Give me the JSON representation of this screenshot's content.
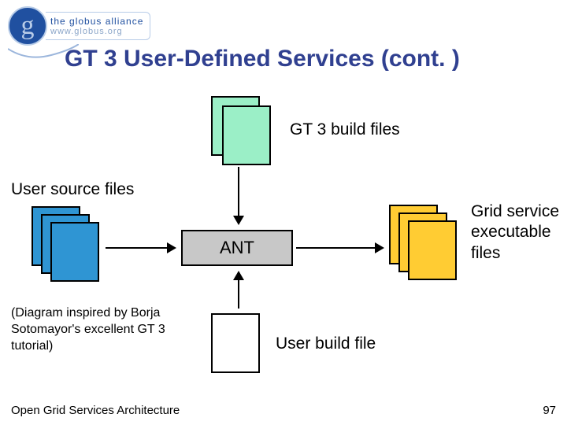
{
  "logo": {
    "letter": "g",
    "line1": "the globus alliance",
    "line2": "www.globus.org"
  },
  "title": "GT 3 User-Defined Services (cont. )",
  "diagram": {
    "gt3_build_files_label": "GT 3 build files",
    "user_source_files_label": "User source files",
    "ant_label": "ANT",
    "grid_service_label": "Grid service executable files",
    "user_build_file_label": "User build file",
    "attribution": "(Diagram inspired by Borja Sotomayor's excellent GT 3 tutorial)",
    "colors": {
      "build_files": "#9befc7",
      "source_files": "#2f95d3",
      "exec_files": "#ffcc33",
      "user_build_file": "#ffffff",
      "ant_box": "#c8c8c8"
    }
  },
  "footer": {
    "left": "Open Grid Services Architecture",
    "page": "97"
  }
}
